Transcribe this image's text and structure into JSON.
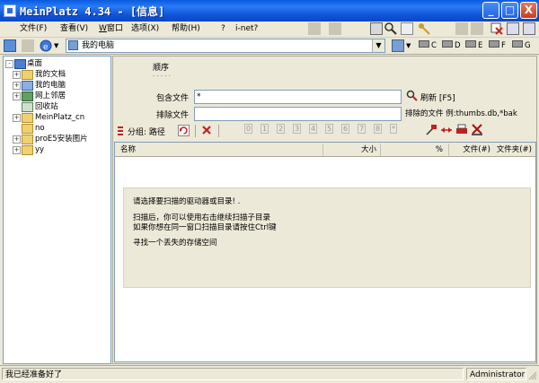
{
  "window": {
    "title": "MeinPlatz 4.34 - [信息]",
    "controls": {
      "minimize": "_",
      "maximize": "□",
      "close": "X"
    }
  },
  "menu": {
    "items": [
      "文件(F)",
      "查看(V)",
      "窗口",
      "选项(X)",
      "帮助(H)"
    ],
    "help_icon": "?",
    "inet": "i-net?"
  },
  "address": {
    "drive_label": "我的电脑",
    "drives": [
      "C",
      "D",
      "E",
      "F",
      "G"
    ]
  },
  "tree": {
    "items": [
      {
        "label": "桌面",
        "level": 0,
        "expander": "-",
        "icon": "desktop-icon"
      },
      {
        "label": "我的文档",
        "level": 1,
        "expander": "+",
        "icon": "documents-folder-icon"
      },
      {
        "label": "我的电脑",
        "level": 1,
        "expander": "+",
        "icon": "computer-icon"
      },
      {
        "label": "网上邻居",
        "level": 1,
        "expander": "+",
        "icon": "network-icon"
      },
      {
        "label": "回收站",
        "level": 1,
        "expander": "",
        "icon": "recycle-bin-icon"
      },
      {
        "label": "MeinPlatz_cn",
        "level": 1,
        "expander": "+",
        "icon": "folder-icon"
      },
      {
        "label": "no",
        "level": 1,
        "expander": "",
        "icon": "folder-icon"
      },
      {
        "label": "proE5安装图片",
        "level": 1,
        "expander": "+",
        "icon": "folder-icon"
      },
      {
        "label": "yy",
        "level": 1,
        "expander": "+",
        "icon": "folder-icon"
      }
    ]
  },
  "filters": {
    "order_label": "顺序",
    "order_dots": "· · · · ·",
    "include_label": "包含文件",
    "include_value": "*",
    "exclude_label": "排除文件",
    "exclude_value": "",
    "refresh_label": "刷新 [F5]",
    "excluded_files_label": "排除的文件 例:thumbs.db,*bak"
  },
  "toolbar2": {
    "group_label": "分组: 路径",
    "level_buttons": [
      "0",
      "1",
      "2",
      "3",
      "4",
      "5",
      "6",
      "7",
      "8",
      "*"
    ]
  },
  "list": {
    "columns": [
      "名称",
      "大小",
      "%",
      "文件(#)",
      "文件夹(#)"
    ],
    "message": {
      "line1": "请选择要扫描的驱动器或目录! .",
      "line2": "扫描后，你可以使用右击继续扫描子目录",
      "line3": "如果你想在同一窗口扫描目录请按住Ctrl键",
      "line4": "寻找一个丢失的存储空间"
    }
  },
  "status": {
    "left": "我已经准备好了",
    "user": "Administrator"
  },
  "colors": {
    "titlebar": "#0a5ae0",
    "background": "#ece9d8",
    "border": "#7f9db9"
  }
}
